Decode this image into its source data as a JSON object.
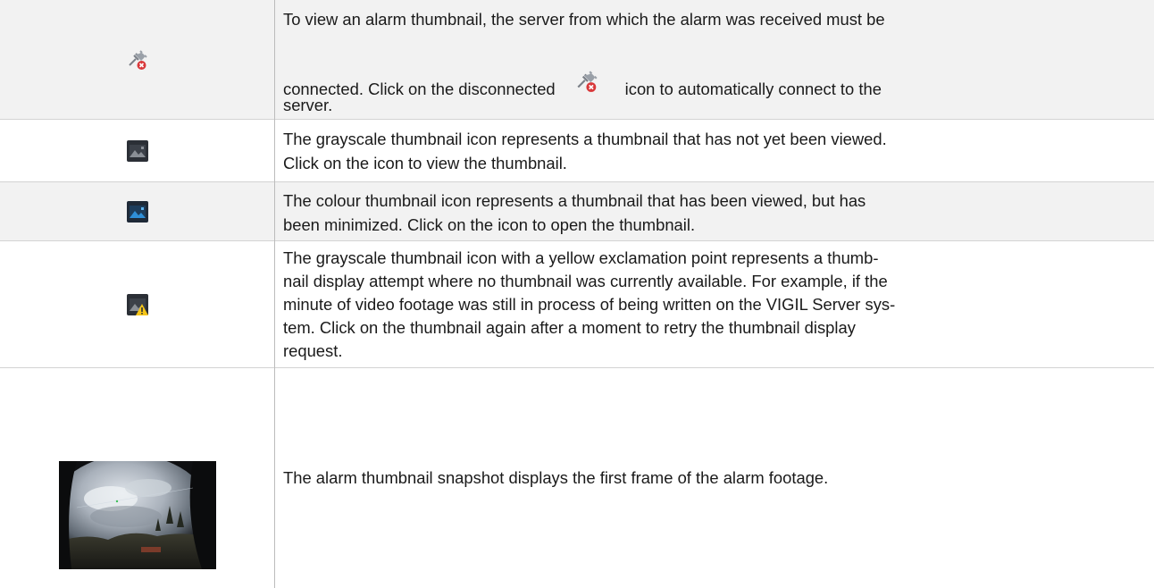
{
  "rows": [
    {
      "icon": "disconnected-server-icon",
      "text_before": "To view an alarm thumbnail, the server from which the alarm was received must be",
      "text_mid": "connected. Click on the disconnected",
      "text_after": "icon to automatically connect to the",
      "text_end": "server."
    },
    {
      "icon": "grayscale-thumbnail-icon",
      "lines": [
        "The grayscale thumbnail icon represents a thumbnail that has not yet been viewed.",
        "Click on the icon to view the thumbnail."
      ]
    },
    {
      "icon": "colour-thumbnail-icon",
      "lines": [
        "The colour thumbnail icon represents a thumbnail that has been viewed, but has",
        "been minimized. Click on the icon to open the thumbnail."
      ]
    },
    {
      "icon": "thumbnail-warning-icon",
      "lines": [
        "The grayscale thumbnail icon with a yellow exclamation point represents a thumb-",
        "nail display attempt where no thumbnail was currently available. For example, if the",
        "minute of video footage was still in process of being written on the VIGIL Server sys-",
        "tem. Click on the thumbnail again after a moment to retry the thumbnail display",
        "request."
      ]
    },
    {
      "icon": "alarm-snapshot-image",
      "lines": [
        "The alarm thumbnail snapshot displays the first frame of the alarm footage."
      ]
    }
  ],
  "colors": {
    "row_shade": "#f2f2f2",
    "border": "#d3d3d3",
    "divider": "#bcbcbc",
    "icon_dark": "#2b2f36",
    "thumb_blue": "#2f8fd8",
    "warning_yellow": "#f5c518",
    "disconnect_red": "#d9383a"
  }
}
